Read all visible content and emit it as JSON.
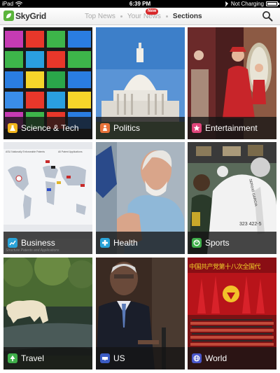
{
  "status_bar": {
    "device": "iPad",
    "time": "6:39 PM",
    "charging": "Not Charging"
  },
  "header": {
    "logo_text": "SkyGrid",
    "tabs": [
      {
        "label": "Top News"
      },
      {
        "label": "Your News",
        "badge": "New"
      },
      {
        "label": "Sections",
        "active": true
      }
    ]
  },
  "sections": [
    {
      "label": "Science & Tech",
      "icon": "flask-icon",
      "icon_color": "#f2b51c"
    },
    {
      "label": "Politics",
      "icon": "podium-icon",
      "icon_color": "#e8733a"
    },
    {
      "label": "Entertainment",
      "icon": "star-icon",
      "icon_color": "#e0447a"
    },
    {
      "label": "Business",
      "icon": "chart-icon",
      "icon_color": "#2aa3d8"
    },
    {
      "label": "Health",
      "icon": "cross-icon",
      "icon_color": "#2aa3d8"
    },
    {
      "label": "Sports",
      "icon": "ball-icon",
      "icon_color": "#3fae4a"
    },
    {
      "label": "Travel",
      "icon": "tree-icon",
      "icon_color": "#3fae4a"
    },
    {
      "label": "US",
      "icon": "us-icon",
      "icon_color": "#3b5cc4"
    },
    {
      "label": "World",
      "icon": "globe-icon",
      "icon_color": "#4a57c9"
    }
  ],
  "tile_art": {
    "business_chart_text": "ASU Nationally Enforceable Patents",
    "business_chart_subtitle": "Structure Patents and Applications",
    "business_legend": "All Patent Applications",
    "sports_shirt_text": "SERGIO GARCIA",
    "sports_shirt_number": "323 422-5",
    "world_banner": "中国共产党第十八次全国代"
  }
}
